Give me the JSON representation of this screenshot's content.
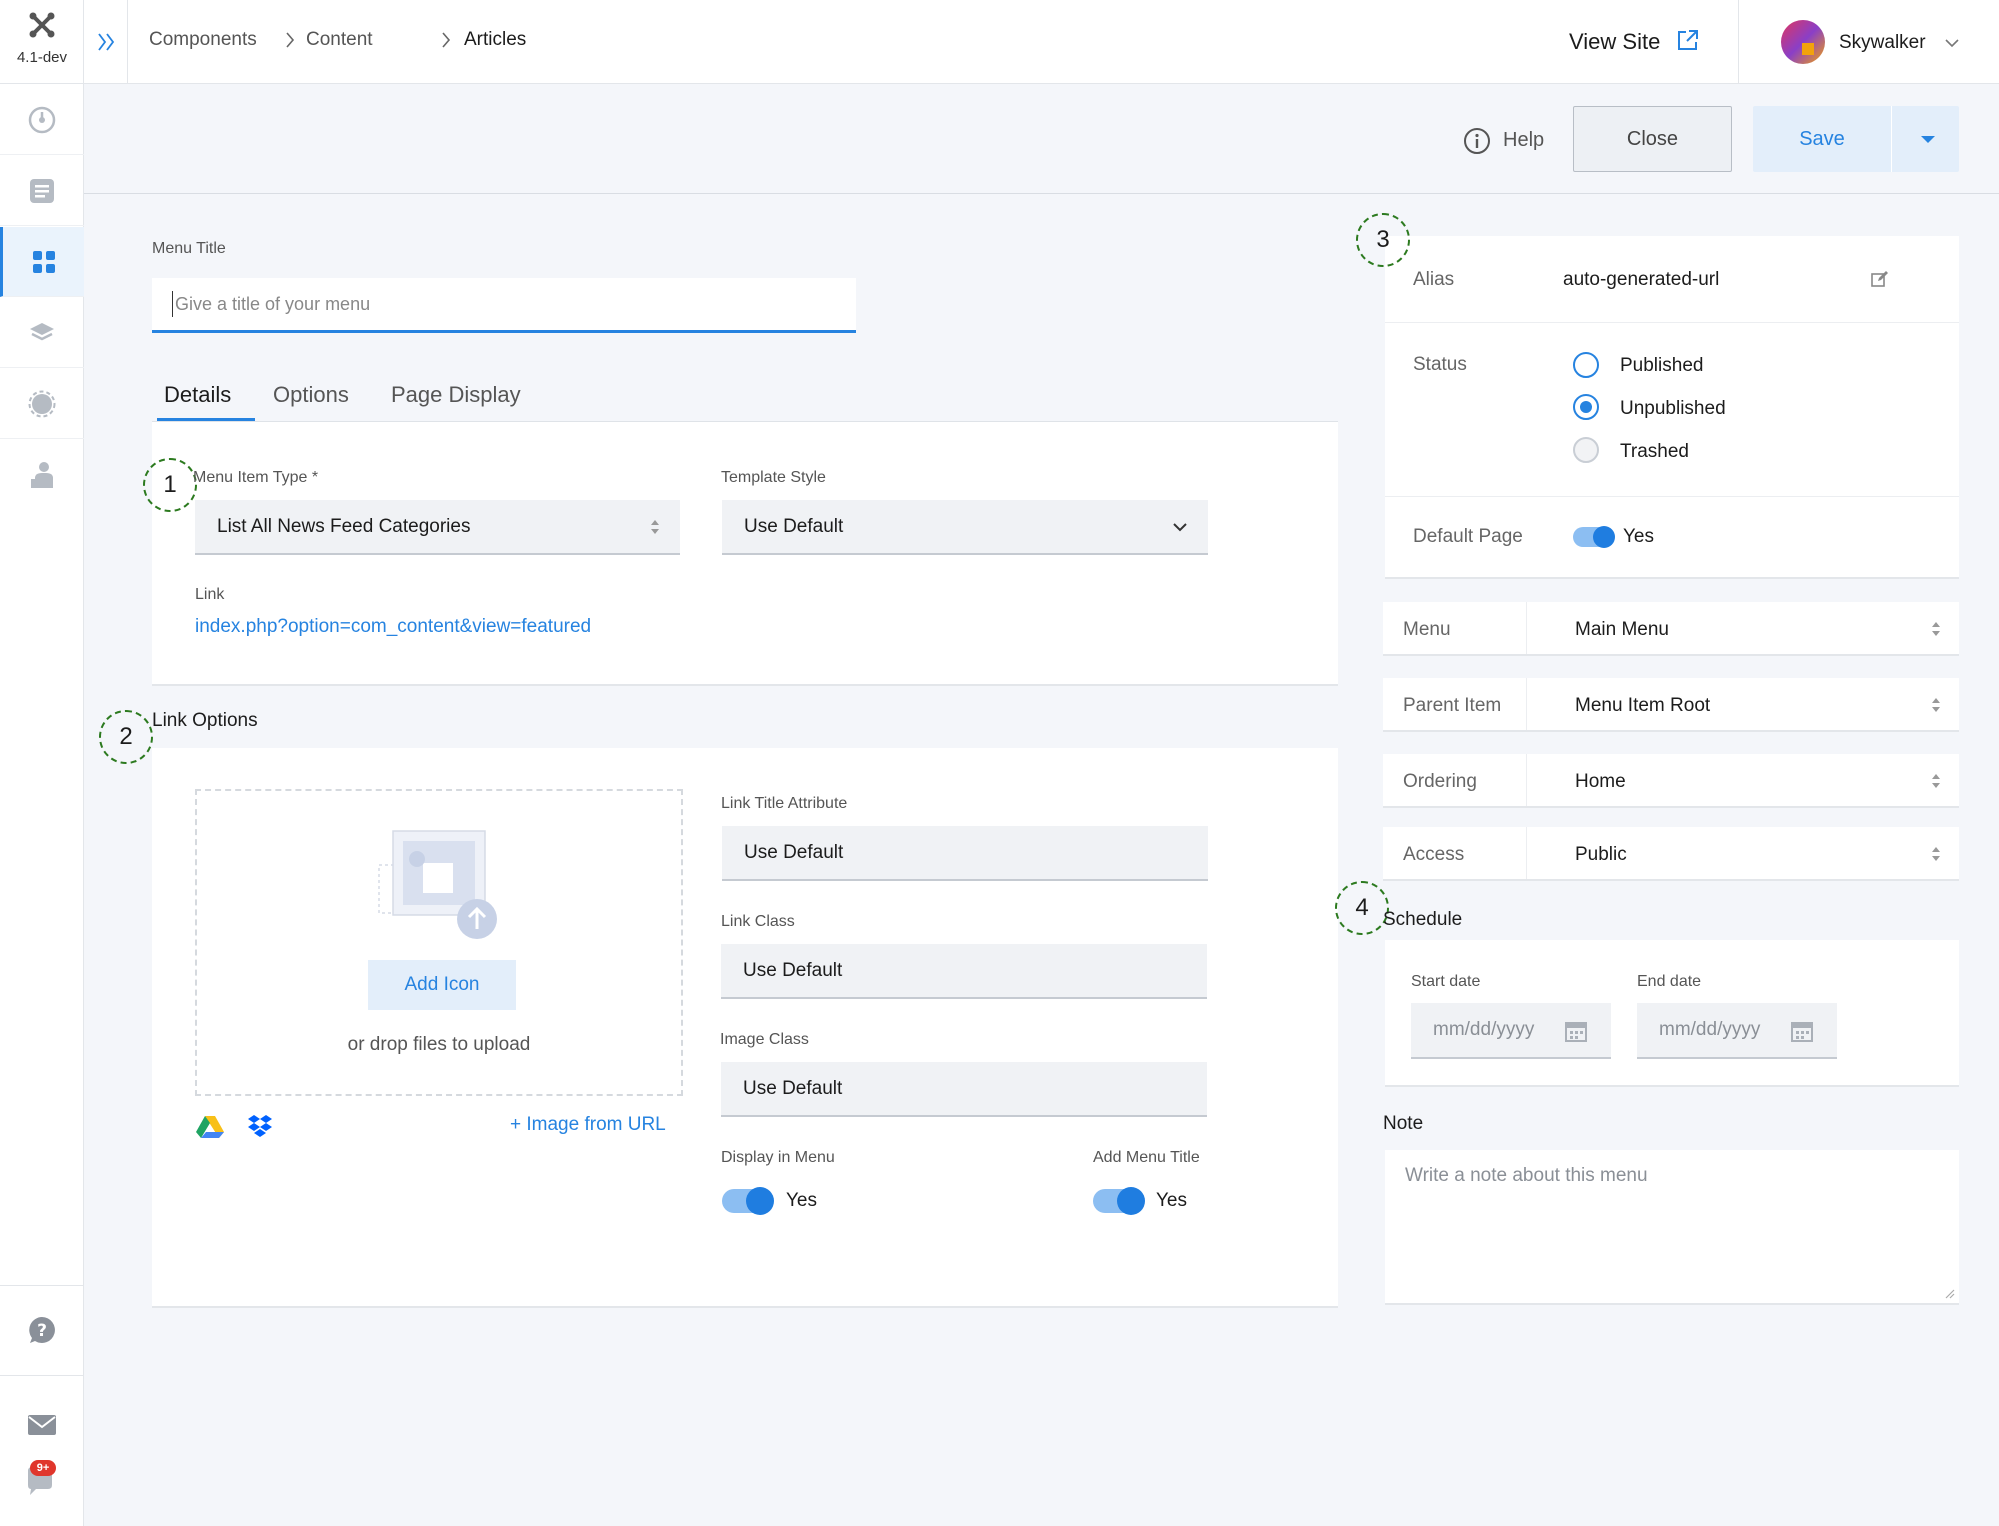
{
  "app": {
    "version": "4.1-dev"
  },
  "breadcrumbs": [
    "Components",
    "Content",
    "Articles"
  ],
  "header": {
    "view_site": "View Site",
    "user": "Skywalker"
  },
  "toolbar": {
    "help": "Help",
    "close": "Close",
    "save": "Save"
  },
  "form": {
    "menu_title_label": "Menu Title",
    "menu_title_placeholder": "Give a title of your menu",
    "tabs": [
      "Details",
      "Options",
      "Page Display"
    ],
    "menu_item_type_label": "Menu Item Type *",
    "menu_item_type_value": "List All News Feed Categories",
    "template_style_label": "Template Style",
    "template_style_value": "Use Default",
    "link_label": "Link",
    "link_value": "index.php?option=com_content&view=featured",
    "link_options_heading": "Link Options",
    "add_icon": "Add Icon",
    "drop_hint": "or drop files to upload",
    "image_from_url": "+ Image from URL",
    "link_title_attr_label": "Link Title Attribute",
    "link_title_attr_value": "Use Default",
    "link_class_label": "Link Class",
    "link_class_value": "Use Default",
    "image_class_label": "Image Class",
    "image_class_value": "Use Default",
    "display_in_menu_label": "Display in Menu",
    "display_in_menu_value": "Yes",
    "add_menu_title_label": "Add Menu Title",
    "add_menu_title_value": "Yes"
  },
  "markers": [
    "1",
    "2",
    "3",
    "4"
  ],
  "side": {
    "alias_label": "Alias",
    "alias_value": "auto-generated-url",
    "status_label": "Status",
    "status_options": [
      "Published",
      "Unpublished",
      "Trashed"
    ],
    "status_selected": "Unpublished",
    "default_page_label": "Default Page",
    "default_page_value": "Yes",
    "selects": [
      {
        "label": "Menu",
        "value": "Main Menu"
      },
      {
        "label": "Parent Item",
        "value": "Menu Item Root"
      },
      {
        "label": "Ordering",
        "value": "Home"
      },
      {
        "label": "Access",
        "value": "Public"
      }
    ],
    "schedule_heading": "Schedule",
    "start_date_label": "Start date",
    "end_date_label": "End date",
    "date_placeholder": "mm/dd/yyyy",
    "note_label": "Note",
    "note_placeholder": "Write a note about this menu"
  },
  "notifications_badge": "9+",
  "colors": {
    "accent": "#2683e0",
    "marker": "#2c7a1f",
    "badge": "#e0362c"
  }
}
